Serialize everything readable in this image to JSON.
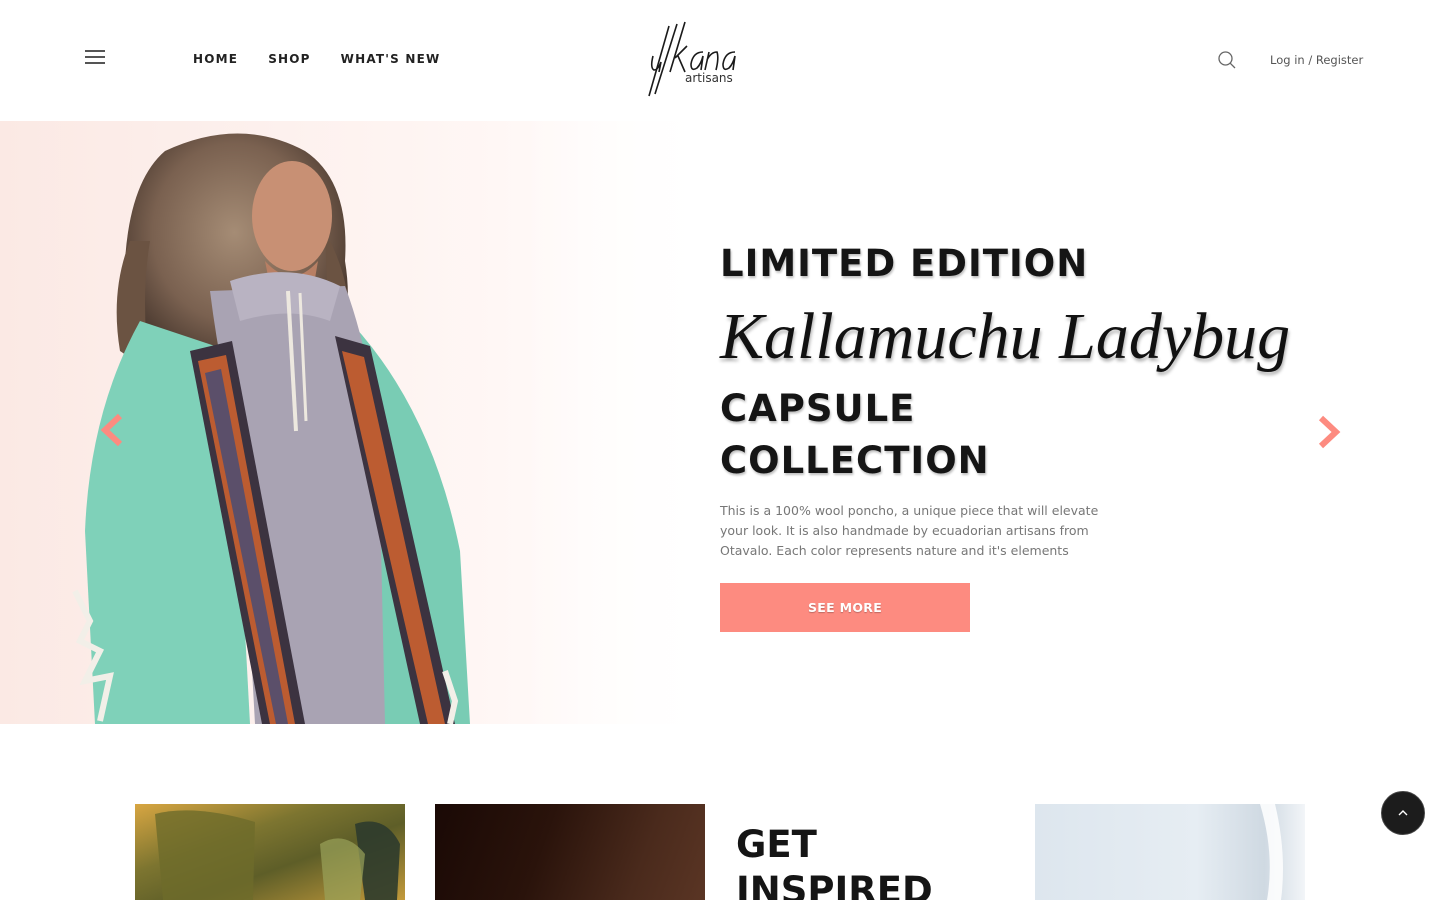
{
  "header": {
    "nav": [
      {
        "label": "HOME"
      },
      {
        "label": "SHOP"
      },
      {
        "label": "WHAT'S NEW"
      }
    ],
    "logo": {
      "wordmark": "ullkana",
      "sub": "artisans"
    },
    "login_label": "Log in / Register",
    "icons": {
      "menu": "hamburger-menu-icon",
      "search": "search-icon"
    }
  },
  "hero": {
    "eyebrow": "LIMITED EDITION",
    "product_name": "Kallamuchu Ladybug",
    "collection_line1": "CAPSULE",
    "collection_line2": "COLLECTION",
    "description": "This is a 100% wool poncho, a unique piece that will elevate your look. It is also handmade by ecuadorian artisans from Otavalo. Each color represents nature and it's elements",
    "cta_label": "SEE MORE",
    "icons": {
      "prev": "chevron-left-icon",
      "next": "chevron-right-icon"
    }
  },
  "tiles": {
    "inspired_line1": "GET",
    "inspired_line2": "INSPIRED"
  },
  "colors": {
    "accent": "#fd8b80",
    "text_dark": "#151515",
    "text_muted": "#777777",
    "poncho_mint": "#7fd1b9",
    "poncho_grey": "#a9a3b3",
    "poncho_orange": "#d2642f"
  },
  "scroll_top_icon": "chevron-up-icon"
}
